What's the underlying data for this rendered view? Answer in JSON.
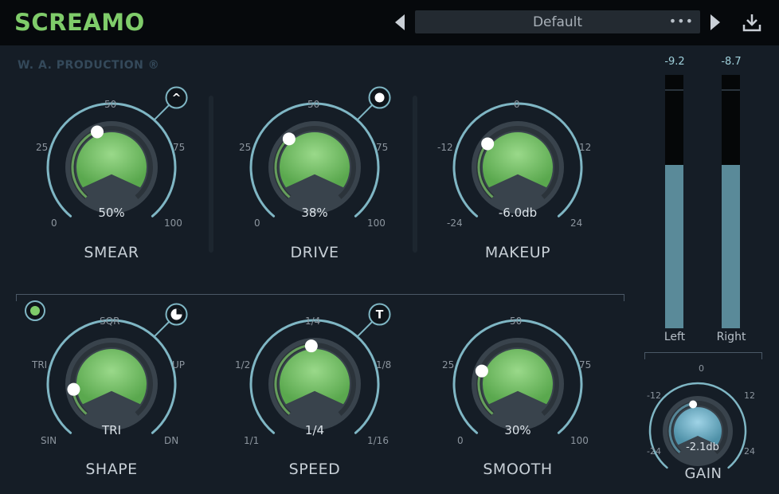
{
  "header": {
    "title": "SCREAMO"
  },
  "preset": {
    "name": "Default",
    "menu": "•••"
  },
  "brand": "W. A. PRODUCTION ®",
  "knobs": {
    "smear": {
      "label": "SMEAR",
      "value": "50%",
      "ticks": [
        "0",
        "25",
        "50",
        "75",
        "100"
      ],
      "button": "^"
    },
    "drive": {
      "label": "DRIVE",
      "value": "38%",
      "ticks": [
        "0",
        "25",
        "50",
        "75",
        "100"
      ]
    },
    "makeup": {
      "label": "MAKEUP",
      "value": "-6.0db",
      "ticks": [
        "-24",
        "-12",
        "0",
        "12",
        "24"
      ]
    },
    "shape": {
      "label": "SHAPE",
      "value": "TRI",
      "ticks": [
        "SIN",
        "TRI",
        "SQR",
        "UP",
        "DN"
      ]
    },
    "speed": {
      "label": "SPEED",
      "value": "1/4",
      "ticks": [
        "1/1",
        "1/2",
        "1/4",
        "1/8",
        "1/16"
      ],
      "button": "T"
    },
    "smooth": {
      "label": "SMOOTH",
      "value": "30%",
      "ticks": [
        "0",
        "25",
        "50",
        "75",
        "100"
      ]
    },
    "gain": {
      "label": "GAIN",
      "value": "-2.1db",
      "ticks": [
        "-24",
        "-12",
        "0",
        "12",
        "24"
      ]
    }
  },
  "meters": {
    "left": {
      "label": "Left",
      "value": "-9.2"
    },
    "right": {
      "label": "Right",
      "value": "-8.7"
    }
  },
  "colors": {
    "accent": "#7fcc6a",
    "ring": "#7fb6c4",
    "title": "#7fcc6a"
  }
}
